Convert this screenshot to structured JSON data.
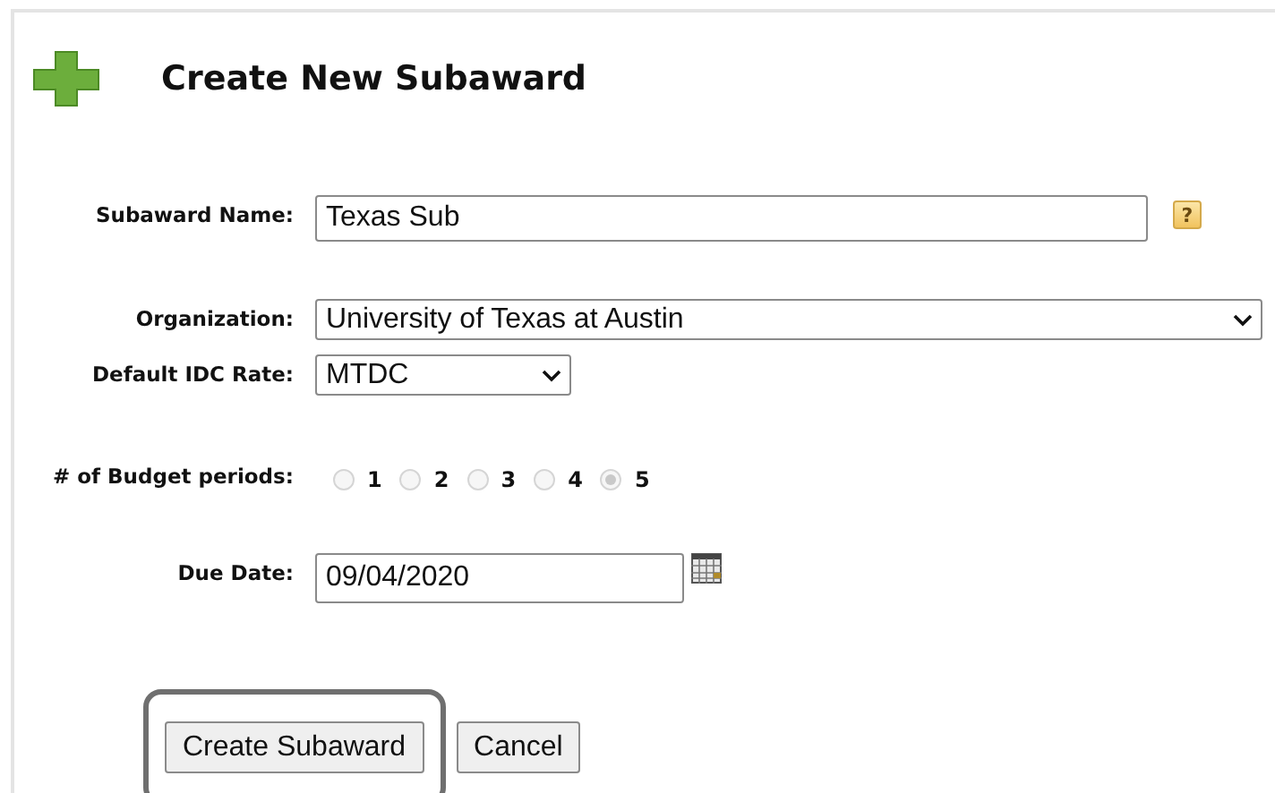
{
  "title": "Create New Subaward",
  "subaward_name": {
    "label": "Subaward Name:",
    "value": "Texas Sub",
    "help": "?"
  },
  "organization": {
    "label": "Organization:",
    "value": "University of Texas at Austin"
  },
  "idc_rate": {
    "label": "Default IDC Rate:",
    "value": "MTDC"
  },
  "budget_periods": {
    "label": "# of Budget periods:",
    "disabled": true,
    "options": [
      {
        "label": "1",
        "selected": false
      },
      {
        "label": "2",
        "selected": false
      },
      {
        "label": "3",
        "selected": false
      },
      {
        "label": "4",
        "selected": false
      },
      {
        "label": "5",
        "selected": true
      }
    ]
  },
  "due_date": {
    "label": "Due Date:",
    "value": "09/04/2020"
  },
  "buttons": [
    {
      "label": "Create Subaward",
      "highlighted": true
    },
    {
      "label": "Cancel",
      "highlighted": false
    }
  ]
}
